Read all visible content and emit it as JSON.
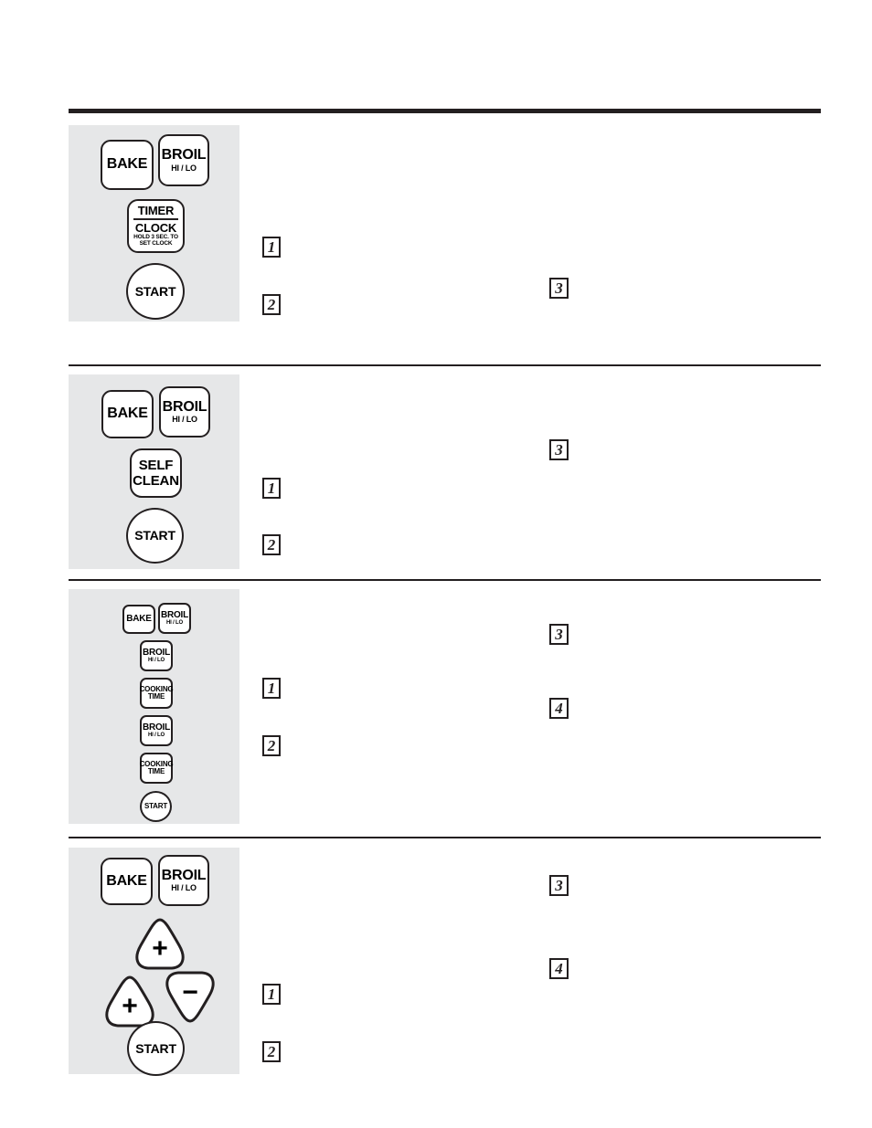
{
  "page": {
    "background_color": "#ffffff",
    "rule_color": "#231f20",
    "panel_color": "#e6e7e8",
    "key_fill": "#ffffff",
    "key_stroke": "#231f20"
  },
  "sections": [
    {
      "id": "set-clock",
      "keys": [
        {
          "name": "bake-key",
          "shape": "rounded-rect",
          "lines": [
            "BAKE"
          ]
        },
        {
          "name": "broil-hi-lo-key",
          "shape": "rounded-rect",
          "lines": [
            "BROIL",
            "HI / LO"
          ]
        },
        {
          "name": "timer-clock-key",
          "shape": "rounded-rect",
          "lines": [
            "TIMER",
            "CLOCK",
            "HOLD 3 SEC. TO",
            "SET CLOCK"
          ]
        },
        {
          "name": "start-key",
          "shape": "circle",
          "lines": [
            "START"
          ]
        }
      ],
      "markers": [
        "1",
        "2",
        "3"
      ]
    },
    {
      "id": "self-clean",
      "keys": [
        {
          "name": "bake-key",
          "shape": "rounded-rect",
          "lines": [
            "BAKE"
          ]
        },
        {
          "name": "broil-hi-lo-key",
          "shape": "rounded-rect",
          "lines": [
            "BROIL",
            "HI / LO"
          ]
        },
        {
          "name": "self-clean-key",
          "shape": "rounded-rect",
          "lines": [
            "SELF",
            "CLEAN"
          ]
        },
        {
          "name": "start-key",
          "shape": "circle",
          "lines": [
            "START"
          ]
        }
      ],
      "markers": [
        "1",
        "2",
        "3"
      ]
    },
    {
      "id": "timed-baking",
      "keys": [
        {
          "name": "bake-key",
          "shape": "rounded-rect",
          "lines": [
            "BAKE"
          ]
        },
        {
          "name": "broil-hi-lo-key",
          "shape": "rounded-rect",
          "lines": [
            "BROIL",
            "HI / LO"
          ]
        },
        {
          "name": "broil-hi-lo-key-2",
          "shape": "rounded-rect",
          "lines": [
            "BROIL",
            "HI / LO"
          ]
        },
        {
          "name": "cooking-time-key",
          "shape": "rounded-rect",
          "lines": [
            "COOKING",
            "TIME"
          ]
        },
        {
          "name": "broil-hi-lo-key-3",
          "shape": "rounded-rect",
          "lines": [
            "BROIL",
            "HI / LO"
          ]
        },
        {
          "name": "cooking-time-key-2",
          "shape": "rounded-rect",
          "lines": [
            "COOKING",
            "TIME"
          ]
        },
        {
          "name": "start-key",
          "shape": "circle",
          "lines": [
            "START"
          ]
        }
      ],
      "markers": [
        "1",
        "2",
        "3",
        "4"
      ]
    },
    {
      "id": "delay-start",
      "keys": [
        {
          "name": "bake-key",
          "shape": "rounded-rect",
          "lines": [
            "BAKE"
          ]
        },
        {
          "name": "broil-hi-lo-key",
          "shape": "rounded-rect",
          "lines": [
            "BROIL",
            "HI / LO"
          ]
        },
        {
          "name": "plus-key",
          "shape": "triangle-up",
          "lines": [
            "+"
          ]
        },
        {
          "name": "plus-key-2",
          "shape": "triangle-up",
          "lines": [
            "+"
          ]
        },
        {
          "name": "minus-key",
          "shape": "triangle-down",
          "lines": [
            "−"
          ]
        },
        {
          "name": "start-key",
          "shape": "circle",
          "lines": [
            "START"
          ]
        }
      ],
      "markers": [
        "1",
        "2",
        "3",
        "4"
      ]
    }
  ]
}
